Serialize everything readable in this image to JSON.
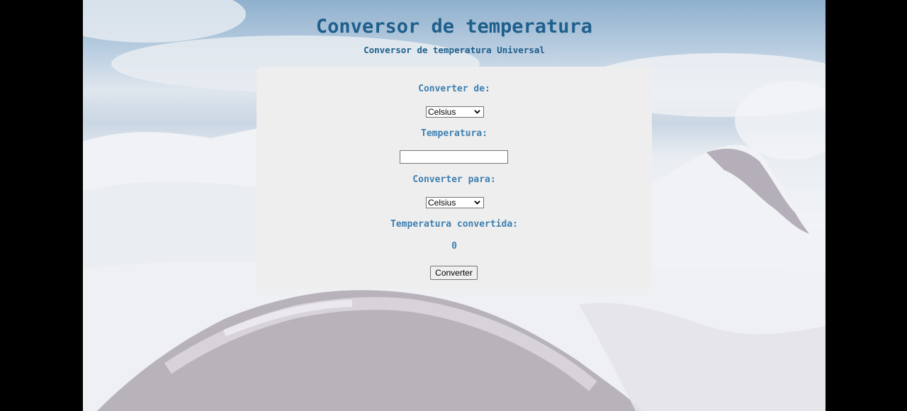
{
  "page": {
    "title": "Conversor de temperatura",
    "subtitle": "Conversor de temperatura Universal"
  },
  "form": {
    "from_label": "Converter de:",
    "from_selected": "Celsius",
    "temperature_label": "Temperatura:",
    "temperature_value": "",
    "to_label": "Converter para:",
    "to_selected": "Celsius",
    "result_label": "Temperatura convertida:",
    "result_value": "0",
    "convert_button": "Converter"
  },
  "colors": {
    "title": "#1f5f8b",
    "label": "#3e7fb0",
    "card_bg": "#eeeeee",
    "outer_bg": "#000000"
  },
  "icons": {
    "select_arrow": "chevron-down-icon"
  }
}
